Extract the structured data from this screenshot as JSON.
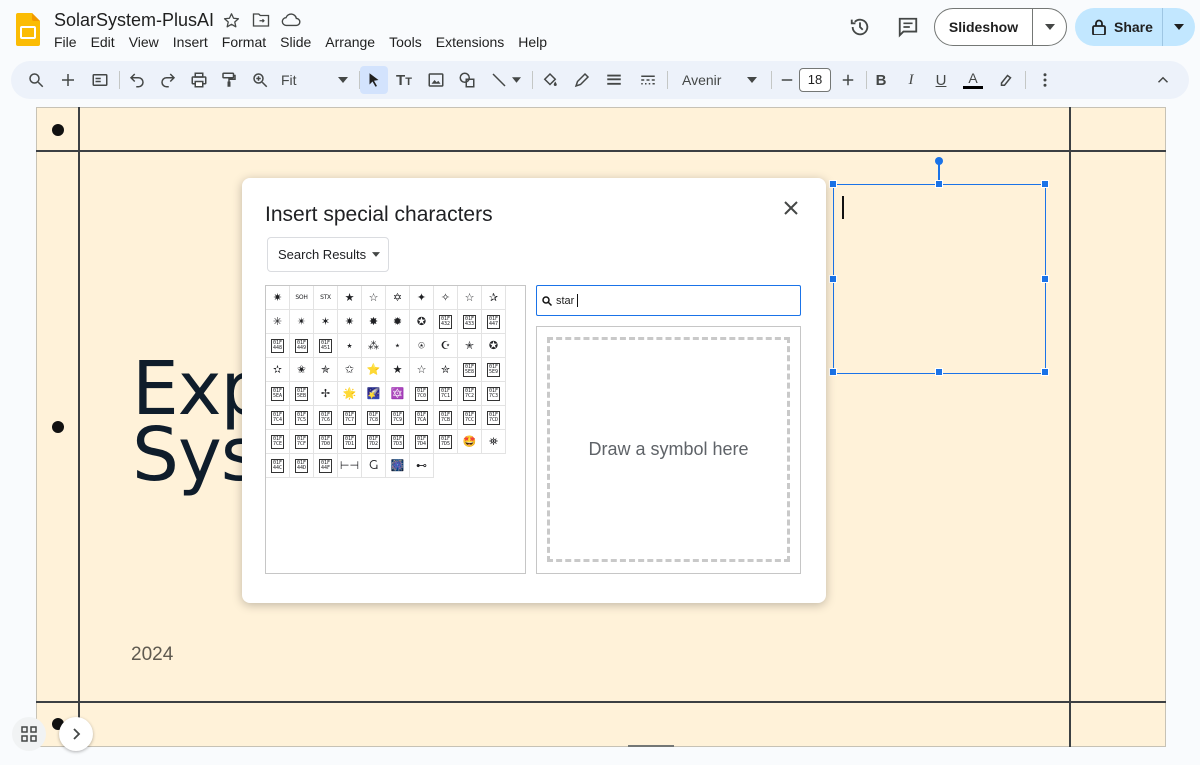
{
  "app": {
    "doc_title": "SolarSystem-PlusAI",
    "menu": [
      "File",
      "Edit",
      "View",
      "Insert",
      "Format",
      "Slide",
      "Arrange",
      "Tools",
      "Extensions",
      "Help"
    ],
    "slideshow_label": "Slideshow",
    "share_label": "Share"
  },
  "toolbar": {
    "zoom_value": "Fit",
    "font_family": "Avenir",
    "font_size": "18",
    "bold": "B",
    "italic": "I",
    "underline": "U",
    "text_color_glyph": "A"
  },
  "slide": {
    "title_line1": "Exp",
    "title_line2": "Sys",
    "year": "2024"
  },
  "dialog": {
    "title": "Insert special characters",
    "category": "Search Results",
    "search_value": "star",
    "draw_placeholder": "Draw a symbol here",
    "characters": [
      [
        "✷",
        "SOH",
        "STX",
        "★",
        "☆",
        "✡",
        "✦",
        "✧",
        "☆",
        "✰"
      ],
      [
        "✳",
        "✴",
        "✶",
        "✷",
        "✸",
        "✹",
        "✪",
        "01F\n432",
        "01F\n433",
        "01F\n447"
      ],
      [
        "01F\n448",
        "01F\n449",
        "01F\n451",
        "٭",
        "⁂",
        "⋆",
        "⍟",
        "☪",
        "✭",
        "✪"
      ],
      [
        "✫",
        "✬",
        "✯",
        "✩",
        "⭐",
        "★",
        "☆",
        "✮",
        "01F\n5E8",
        "01F\n5E9"
      ],
      [
        "01F\n5EA",
        "01F\n5EB",
        "✢",
        "🌟",
        "🌠",
        "🔯",
        "01F\n7C0",
        "01F\n7C1",
        "01F\n7C2",
        "01F\n7C3"
      ],
      [
        "01F\n7C4",
        "01F\n7C5",
        "01F\n7C6",
        "01F\n7C7",
        "01F\n7C8",
        "01F\n7C9",
        "01F\n7CA",
        "01F\n7CB",
        "01F\n7CC",
        "01F\n7CD"
      ],
      [
        "01F\n7CE",
        "01F\n7CF",
        "01F\n7D0",
        "01F\n7D1",
        "01F\n7D2",
        "01F\n7D3",
        "01F\n7D4",
        "01F\n7D5",
        "🤩",
        "⛯"
      ],
      [
        "01F\n44C",
        "01F\n44D",
        "01F\n44F",
        "⊢⊣",
        "Ⴚ",
        "🎆",
        "⊷"
      ]
    ]
  },
  "colors": {
    "accent": "#1a73e8",
    "slide_bg": "#fff2d9",
    "share_bg": "#c2e7ff",
    "toolbar_bg": "#edf2fa"
  }
}
